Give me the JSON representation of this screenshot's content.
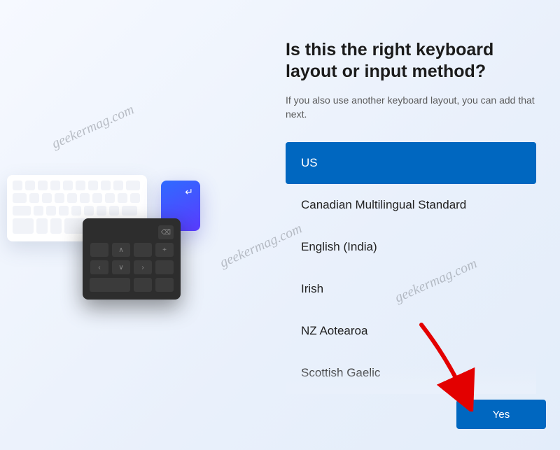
{
  "title": "Is this the right keyboard layout or input method?",
  "subtitle": "If you also use another keyboard layout, you can add that next.",
  "options": [
    {
      "label": "US",
      "selected": true
    },
    {
      "label": "Canadian Multilingual Standard",
      "selected": false
    },
    {
      "label": "English (India)",
      "selected": false
    },
    {
      "label": "Irish",
      "selected": false
    },
    {
      "label": "NZ Aotearoa",
      "selected": false
    },
    {
      "label": "Scottish Gaelic",
      "selected": false
    }
  ],
  "buttons": {
    "yes": "Yes"
  },
  "watermark": "geekermag.com",
  "colors": {
    "accent": "#0067c0"
  }
}
